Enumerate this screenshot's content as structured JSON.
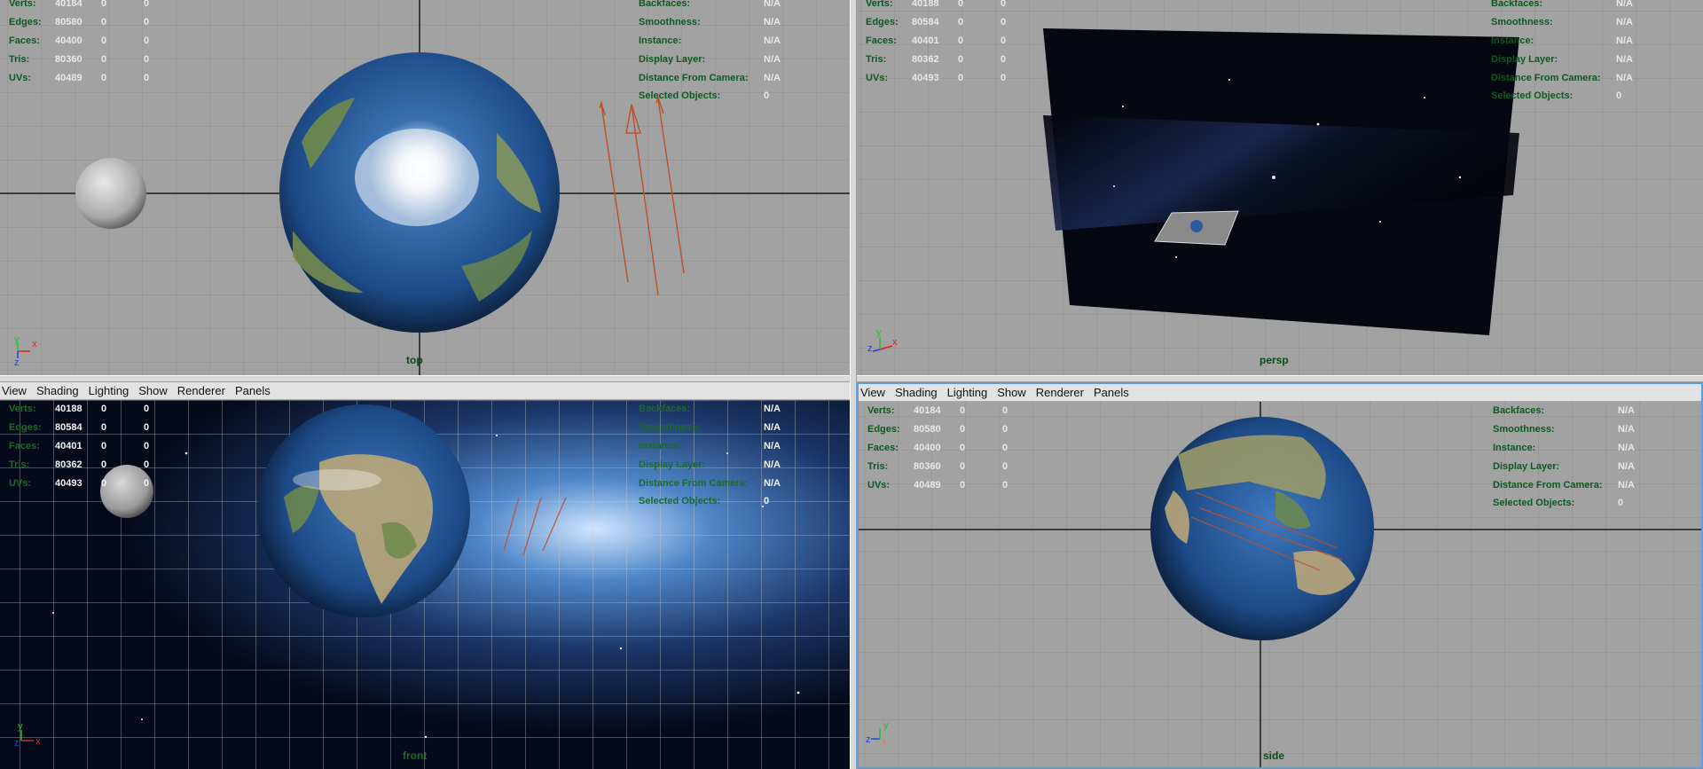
{
  "menu": [
    "View",
    "Shading",
    "Lighting",
    "Show",
    "Renderer",
    "Panels"
  ],
  "hud_stats_labels": [
    "Verts:",
    "Edges:",
    "Faces:",
    "Tris:",
    "UVs:"
  ],
  "hud_right_labels": [
    "Backfaces:",
    "Smoothness:",
    "Instance:",
    "Display Layer:",
    "Distance From Camera:",
    "Selected Objects:"
  ],
  "viewports": {
    "top": {
      "camera": "top",
      "stats": [
        [
          "40184",
          "0",
          "0"
        ],
        [
          "80580",
          "0",
          "0"
        ],
        [
          "40400",
          "0",
          "0"
        ],
        [
          "80360",
          "0",
          "0"
        ],
        [
          "40489",
          "0",
          "0"
        ]
      ],
      "right_values": [
        "N/A",
        "N/A",
        "N/A",
        "N/A",
        "N/A",
        "0"
      ]
    },
    "persp": {
      "camera": "persp",
      "stats": [
        [
          "40188",
          "0",
          "0"
        ],
        [
          "80584",
          "0",
          "0"
        ],
        [
          "40401",
          "0",
          "0"
        ],
        [
          "80362",
          "0",
          "0"
        ],
        [
          "40493",
          "0",
          "0"
        ]
      ],
      "right_values": [
        "N/A",
        "N/A",
        "N/A",
        "N/A",
        "N/A",
        "0"
      ]
    },
    "front": {
      "camera": "front",
      "stats": [
        [
          "40188",
          "0",
          "0"
        ],
        [
          "80584",
          "0",
          "0"
        ],
        [
          "40401",
          "0",
          "0"
        ],
        [
          "80362",
          "0",
          "0"
        ],
        [
          "40493",
          "0",
          "0"
        ]
      ],
      "right_values": [
        "N/A",
        "N/A",
        "N/A",
        "N/A",
        "N/A",
        "0"
      ]
    },
    "side": {
      "camera": "side",
      "stats": [
        [
          "40184",
          "0",
          "0"
        ],
        [
          "80580",
          "0",
          "0"
        ],
        [
          "40400",
          "0",
          "0"
        ],
        [
          "80360",
          "0",
          "0"
        ],
        [
          "40489",
          "0",
          "0"
        ]
      ],
      "right_values": [
        "N/A",
        "N/A",
        "N/A",
        "N/A",
        "N/A",
        "0"
      ]
    }
  },
  "axes": {
    "top": [
      "y",
      "x",
      "z"
    ],
    "persp": [
      "y",
      "x",
      "z"
    ],
    "front": [
      "y",
      "x",
      "z"
    ],
    "side": [
      "y",
      "z",
      "x"
    ]
  },
  "colors": {
    "viewport_bg": "#a2a2a2",
    "grid_line": "#8e8e8e",
    "axis_line": "#1a1a1a",
    "active_border": "#5aa0e0",
    "hud_label": "#0d5a1e",
    "camera_arrow": "#c0502a",
    "ocean": "#1f4f8f",
    "land": "#6f8a4a"
  }
}
